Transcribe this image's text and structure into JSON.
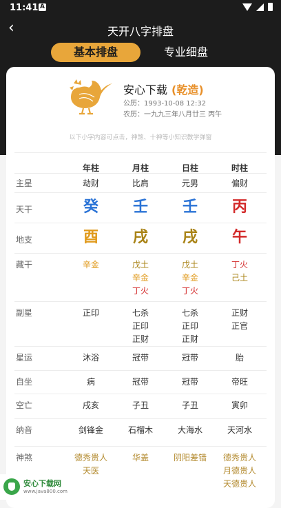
{
  "status": {
    "time": "11:41",
    "notification": "A"
  },
  "nav": {
    "back": "‹",
    "title": "天开八字排盘"
  },
  "tabs": {
    "active": "基本排盘",
    "inactive": "专业细盘"
  },
  "profile": {
    "name": "安心下载",
    "gender": "(乾造)",
    "solar": "公历：1993-10-08 12:32",
    "lunar": "农历：一九九三年八月廿三 丙午"
  },
  "hint": "以下小字内容可点击，神煞、十神等小知识教学弹窗",
  "columns": [
    "年柱",
    "月柱",
    "日柱",
    "时柱"
  ],
  "rows": [
    {
      "label": "主星",
      "cells": [
        [
          "劫财"
        ],
        [
          "比肩"
        ],
        [
          "元男"
        ],
        [
          "偏财"
        ]
      ]
    },
    {
      "label": "天干",
      "big": true,
      "cells": [
        [
          "癸"
        ],
        [
          "壬"
        ],
        [
          "壬"
        ],
        [
          "丙"
        ]
      ]
    },
    {
      "label": "地支",
      "big": true,
      "cells": [
        [
          "酉"
        ],
        [
          "戌"
        ],
        [
          "戌"
        ],
        [
          "午"
        ]
      ]
    },
    {
      "label": "藏干",
      "cells": [
        [
          "辛金"
        ],
        [
          "戊土",
          "辛金",
          "丁火"
        ],
        [
          "戊土",
          "辛金",
          "丁火"
        ],
        [
          "丁火",
          "己土"
        ]
      ]
    },
    {
      "label": "副星",
      "cells": [
        [
          "正印"
        ],
        [
          "七杀",
          "正印",
          "正财"
        ],
        [
          "七杀",
          "正印",
          "正财"
        ],
        [
          "正财",
          "正官"
        ]
      ]
    },
    {
      "label": "星运",
      "cells": [
        [
          "沐浴"
        ],
        [
          "冠带"
        ],
        [
          "冠带"
        ],
        [
          "胎"
        ]
      ]
    },
    {
      "label": "自坐",
      "cells": [
        [
          "病"
        ],
        [
          "冠带"
        ],
        [
          "冠带"
        ],
        [
          "帝旺"
        ]
      ]
    },
    {
      "label": "空亡",
      "cells": [
        [
          "戌亥"
        ],
        [
          "子丑"
        ],
        [
          "子丑"
        ],
        [
          "寅卯"
        ]
      ]
    },
    {
      "label": "纳音",
      "cells": [
        [
          "剑锋金"
        ],
        [
          "石榴木"
        ],
        [
          "大海水"
        ],
        [
          "天河水"
        ]
      ]
    },
    {
      "label": "神煞",
      "cells": [
        [
          "德秀贵人",
          "天医"
        ],
        [
          "华盖"
        ],
        [
          "阴阳差错"
        ],
        [
          "德秀贵人",
          "月德贵人",
          "天德贵人"
        ]
      ]
    }
  ],
  "colors": {
    "accent": "#e8a63a",
    "metal": "#e09a1c",
    "earth": "#a98316",
    "fire": "#d32a2a",
    "water": "#2a73d6",
    "shensha": "#b38a2e"
  },
  "watermark": {
    "text": "安心下载网",
    "url": "www.java800.com"
  }
}
